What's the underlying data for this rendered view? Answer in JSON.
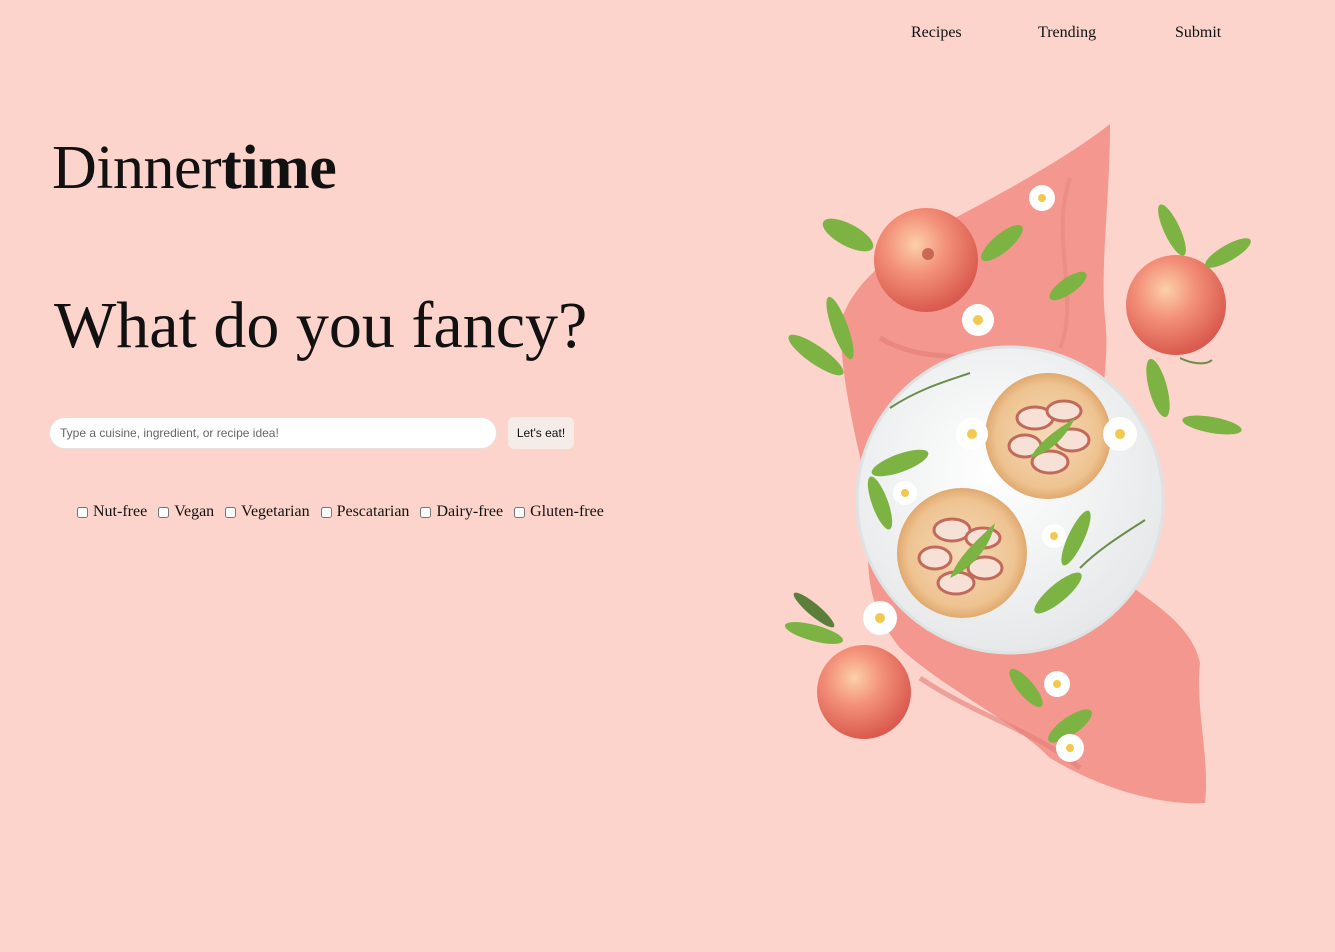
{
  "nav": {
    "items": [
      {
        "label": "Recipes"
      },
      {
        "label": "Trending"
      },
      {
        "label": "Submit"
      }
    ]
  },
  "logo": {
    "regular": "Dinner",
    "bold": "time"
  },
  "headline": "What do you fancy?",
  "search": {
    "placeholder": "Type a cuisine, ingredient, or recipe idea!",
    "value": "",
    "button_label": "Let's eat!"
  },
  "filters": [
    {
      "label": "Nut-free",
      "checked": false
    },
    {
      "label": "Vegan",
      "checked": false
    },
    {
      "label": "Vegetarian",
      "checked": false
    },
    {
      "label": "Pescatarian",
      "checked": false
    },
    {
      "label": "Dairy-free",
      "checked": false
    },
    {
      "label": "Gluten-free",
      "checked": false
    }
  ],
  "colors": {
    "background": "#fcd4cc",
    "cloth": "#f3978f",
    "plate": "#f1f2f2",
    "peach": "#ee7f6a",
    "leaf": "#7cb342"
  }
}
